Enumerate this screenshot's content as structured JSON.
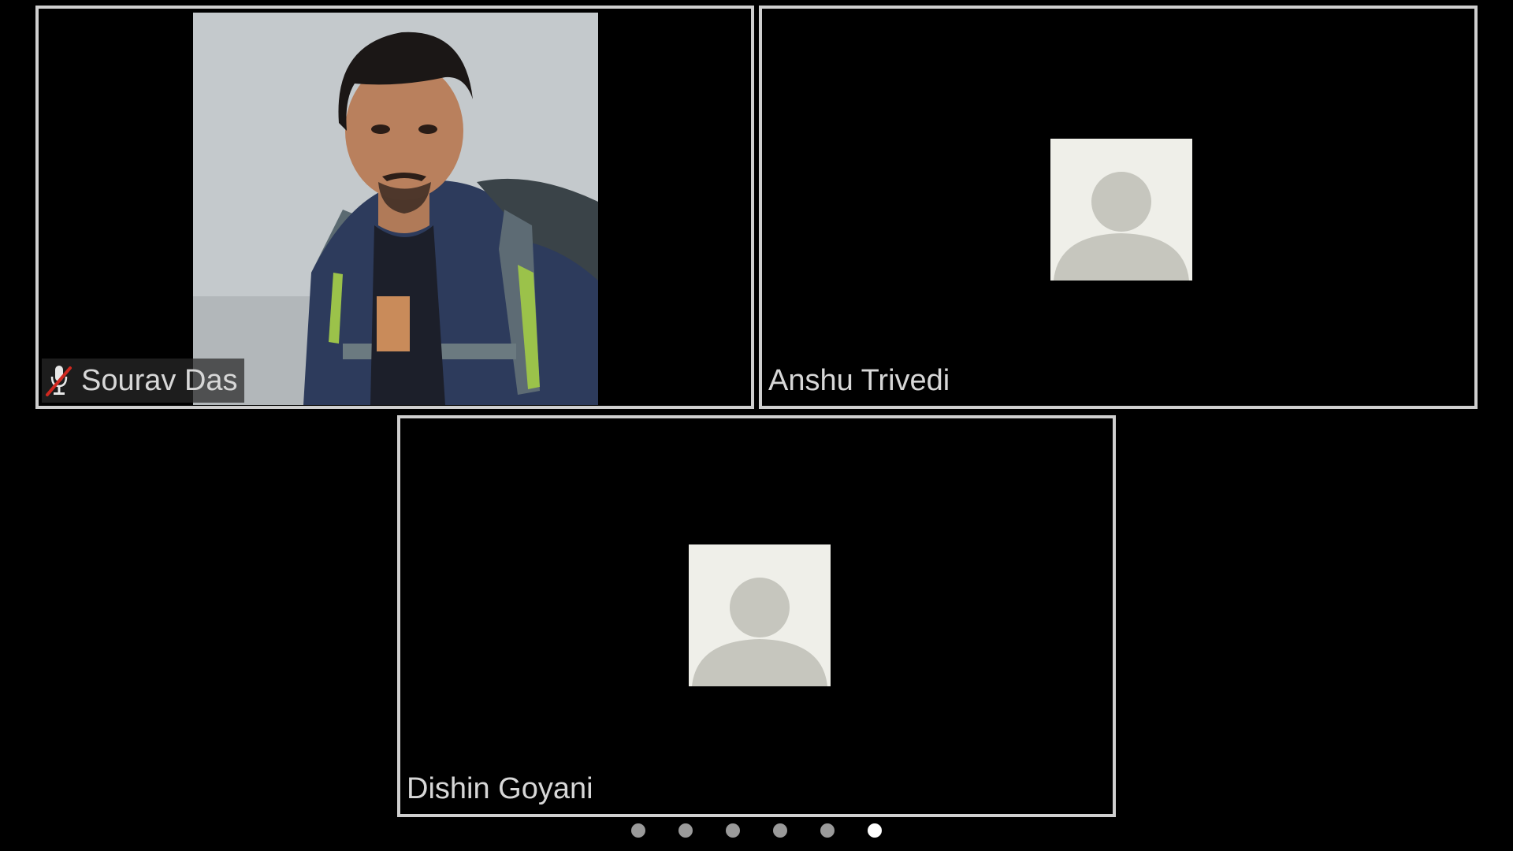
{
  "participants": [
    {
      "name": "Sourav Das",
      "muted": true,
      "video_on": true
    },
    {
      "name": "Anshu Trivedi",
      "muted": false,
      "video_on": false
    },
    {
      "name": "Dishin Goyani",
      "muted": false,
      "video_on": false
    }
  ],
  "icons": {
    "mic_muted": "mic-muted-icon",
    "avatar": "person-placeholder-icon"
  },
  "pager": {
    "pages": 6,
    "current": 6
  },
  "colors": {
    "background": "#000000",
    "tile_border": "#cfcfcf",
    "name_text": "#d7d7d7",
    "avatar_bg": "#efefe9",
    "avatar_fg": "#c6c6be",
    "muted_slash": "#d0281f",
    "dot_inactive": "#9a9a9a",
    "dot_active": "#ffffff"
  }
}
